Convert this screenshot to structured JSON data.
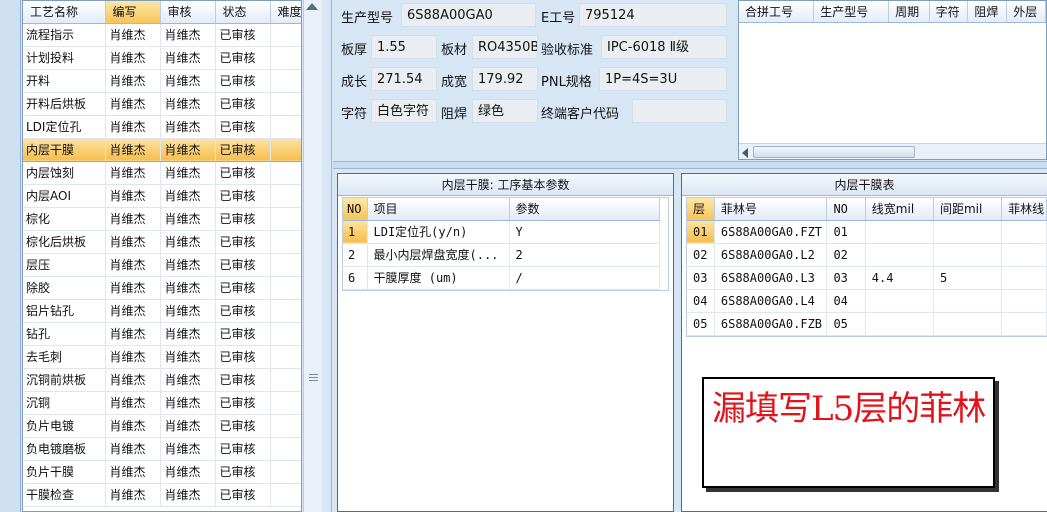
{
  "process_grid": {
    "columns": [
      "工艺名称",
      "编写",
      "审核",
      "状态",
      "难度"
    ],
    "selected_row": 5,
    "rows": [
      [
        "流程指示",
        "肖维杰",
        "肖维杰",
        "已审核",
        ""
      ],
      [
        "计划投料",
        "肖维杰",
        "肖维杰",
        "已审核",
        ""
      ],
      [
        "开料",
        "肖维杰",
        "肖维杰",
        "已审核",
        ""
      ],
      [
        "开料后烘板",
        "肖维杰",
        "肖维杰",
        "已审核",
        ""
      ],
      [
        "LDI定位孔",
        "肖维杰",
        "肖维杰",
        "已审核",
        ""
      ],
      [
        "内层干膜",
        "肖维杰",
        "肖维杰",
        "已审核",
        ""
      ],
      [
        "内层蚀刻",
        "肖维杰",
        "肖维杰",
        "已审核",
        ""
      ],
      [
        "内层AOI",
        "肖维杰",
        "肖维杰",
        "已审核",
        ""
      ],
      [
        "棕化",
        "肖维杰",
        "肖维杰",
        "已审核",
        ""
      ],
      [
        "棕化后烘板",
        "肖维杰",
        "肖维杰",
        "已审核",
        ""
      ],
      [
        "层压",
        "肖维杰",
        "肖维杰",
        "已审核",
        ""
      ],
      [
        "除胶",
        "肖维杰",
        "肖维杰",
        "已审核",
        ""
      ],
      [
        "铝片钻孔",
        "肖维杰",
        "肖维杰",
        "已审核",
        ""
      ],
      [
        "钻孔",
        "肖维杰",
        "肖维杰",
        "已审核",
        ""
      ],
      [
        "去毛刺",
        "肖维杰",
        "肖维杰",
        "已审核",
        ""
      ],
      [
        "沉铜前烘板",
        "肖维杰",
        "肖维杰",
        "已审核",
        ""
      ],
      [
        "沉铜",
        "肖维杰",
        "肖维杰",
        "已审核",
        ""
      ],
      [
        "负片电镀",
        "肖维杰",
        "肖维杰",
        "已审核",
        ""
      ],
      [
        "负电镀磨板",
        "肖维杰",
        "肖维杰",
        "已审核",
        ""
      ],
      [
        "负片干膜",
        "肖维杰",
        "肖维杰",
        "已审核",
        ""
      ],
      [
        "干膜检查",
        "肖维杰",
        "肖维杰",
        "已审核",
        ""
      ]
    ]
  },
  "info": {
    "model_label": "生产型号",
    "model_value": "6S88A00GA0",
    "eno_label": "E工号",
    "eno_value": "795124",
    "thickness_label": "板厚",
    "thickness_value": "1.55",
    "material_label": "板材",
    "material_value": "RO4350B",
    "standard_label": "验收标准",
    "standard_value": "IPC-6018 Ⅱ级",
    "length_label": "成长",
    "length_value": "271.54",
    "width_label": "成宽",
    "width_value": "179.92",
    "pnl_label": "PNL规格",
    "pnl_value": "1P=4S=3U",
    "legend_label": "字符",
    "legend_value": "白色字符",
    "mask_label": "阻焊",
    "mask_value": "绿色",
    "customer_label": "终端客户代码",
    "customer_value": ""
  },
  "merge_table": {
    "columns": [
      "合拼工号",
      "生产型号",
      "周期",
      "字符",
      "阻焊",
      "外层"
    ]
  },
  "params_panel": {
    "title": "内层干膜: 工序基本参数",
    "columns": [
      "NO",
      "项目",
      "参数"
    ],
    "rows": [
      [
        "1",
        "LDI定位孔(y/n)",
        "Y"
      ],
      [
        "2",
        "最小内层焊盘宽度(...",
        "2"
      ],
      [
        "6",
        "干膜厚度 (um)",
        "/"
      ]
    ]
  },
  "film_panel": {
    "title": "内层干膜表",
    "columns": [
      "层",
      "菲林号",
      "NO",
      "线宽mil",
      "间距mil",
      "菲林线"
    ],
    "rows": [
      [
        "01",
        "6S88A00GA0.FZT",
        "01",
        "",
        "",
        ""
      ],
      [
        "02",
        "6S88A00GA0.L2",
        "02",
        "",
        "",
        ""
      ],
      [
        "03",
        "6S88A00GA0.L3",
        "03",
        "4.4",
        "5",
        ""
      ],
      [
        "04",
        "6S88A00GA0.L4",
        "04",
        "",
        "",
        ""
      ],
      [
        "05",
        "6S88A00GA0.FZB",
        "05",
        "",
        "",
        ""
      ]
    ]
  },
  "annotation": {
    "text": "漏填写L5层的菲林",
    "color": "#e0141b"
  }
}
